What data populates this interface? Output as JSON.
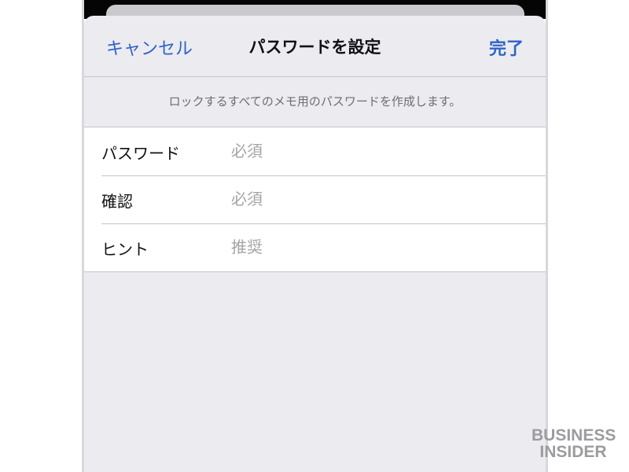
{
  "navbar": {
    "cancel_label": "キャンセル",
    "title": "パスワードを設定",
    "done_label": "完了"
  },
  "description": "ロックするすべてのメモ用のパスワードを作成します。",
  "form": {
    "rows": [
      {
        "label": "パスワード",
        "placeholder": "必須"
      },
      {
        "label": "確認",
        "placeholder": "必須"
      },
      {
        "label": "ヒント",
        "placeholder": "推奨"
      }
    ]
  },
  "watermark": {
    "line1": "BUSINESS",
    "line2": "INSIDER"
  },
  "colors": {
    "accent": "#2f63c7",
    "sheet_background": "#ebebf0",
    "placeholder": "#a4a4a8",
    "separator": "#c6c6c8"
  }
}
